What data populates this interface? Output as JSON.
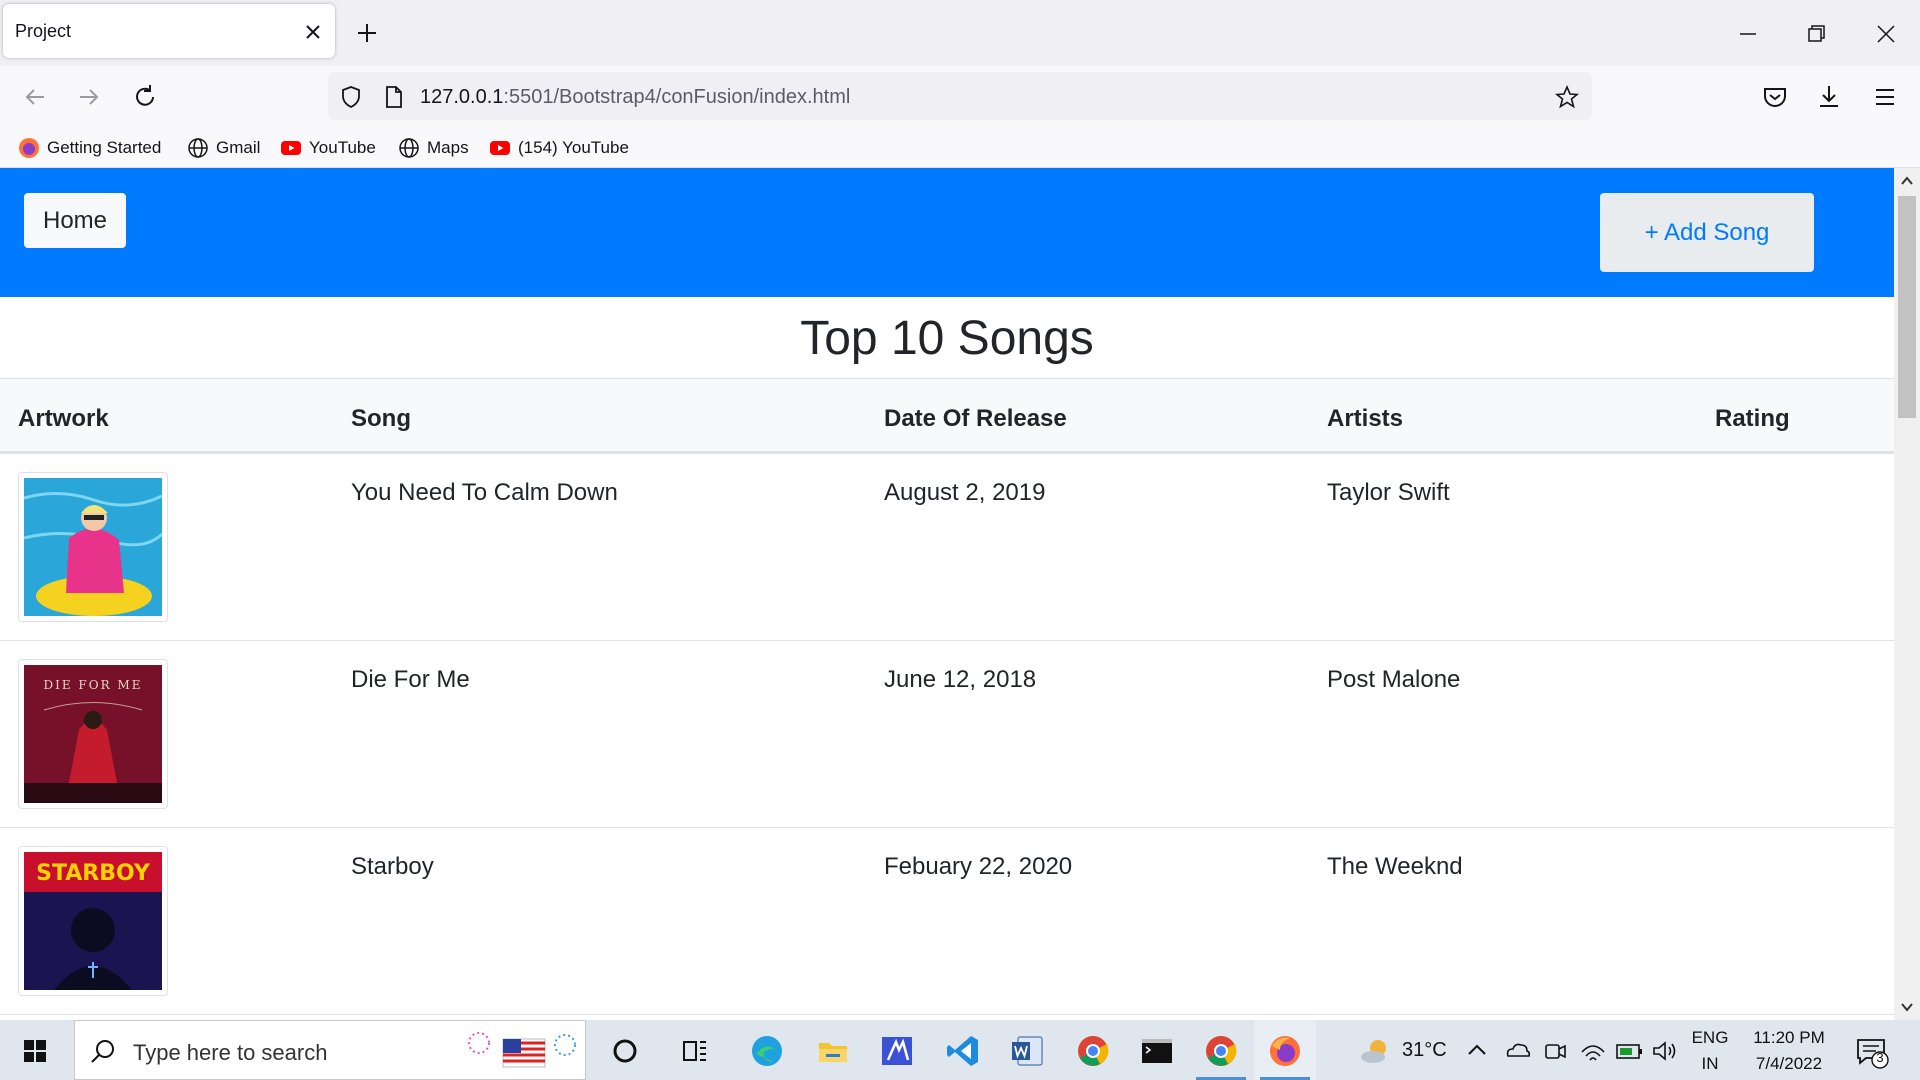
{
  "browser": {
    "tab_title": "Project",
    "url_host": "127.0.0.1",
    "url_path": ":5501/Bootstrap4/conFusion/index.html",
    "bookmarks": [
      "Getting Started",
      "Gmail",
      "YouTube",
      "Maps",
      "(154) YouTube"
    ]
  },
  "page": {
    "home_label": "Home",
    "add_song_label": "+ Add Song",
    "heading": "Top 10 Songs",
    "columns": [
      "Artwork",
      "Song",
      "Date Of Release",
      "Artists",
      "Rating"
    ],
    "rows": [
      {
        "song": "You Need To Calm Down",
        "date": "August 2, 2019",
        "artist": "Taylor Swift",
        "artwork": "swimming-pool-cover"
      },
      {
        "song": "Die For Me",
        "date": "June 12, 2018",
        "artist": "Post Malone",
        "artwork": "die-for-me-cover",
        "artwork_text": "DIE FOR ME"
      },
      {
        "song": "Starboy",
        "date": "Febuary 22, 2020",
        "artist": "The Weeknd",
        "artwork": "starboy-cover",
        "artwork_text": "STARBOY"
      }
    ]
  },
  "taskbar": {
    "search_placeholder": "Type here to search",
    "weather": "31°C",
    "lang_top": "ENG",
    "lang_bottom": "IN",
    "time": "11:20 PM",
    "date": "7/4/2022",
    "notification_count": "3"
  },
  "colors": {
    "navbar_blue": "#007bff",
    "add_button_bg": "#e9ecef"
  }
}
